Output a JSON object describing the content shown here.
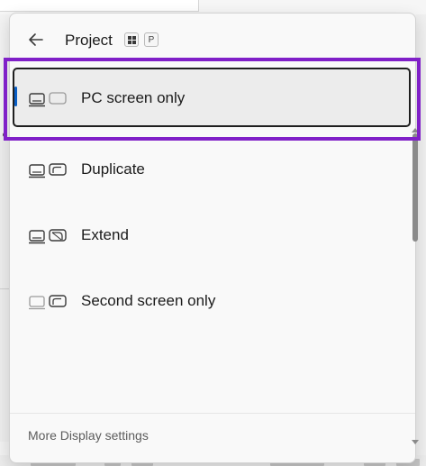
{
  "header": {
    "back_icon": "arrow-left-icon",
    "title": "Project",
    "shortcut": {
      "key1_icon": "windows-logo-icon",
      "key2": "P"
    }
  },
  "options": [
    {
      "label": "PC screen only",
      "icon": "pc-screen-only-icon",
      "selected": true
    },
    {
      "label": "Duplicate",
      "icon": "duplicate-icon",
      "selected": false
    },
    {
      "label": "Extend",
      "icon": "extend-icon",
      "selected": false
    },
    {
      "label": "Second screen only",
      "icon": "second-screen-only-icon",
      "selected": false
    }
  ],
  "footer": {
    "more_settings": "More Display settings"
  },
  "colors": {
    "accent": "#0a5fc6",
    "highlight": "#8020c8"
  }
}
